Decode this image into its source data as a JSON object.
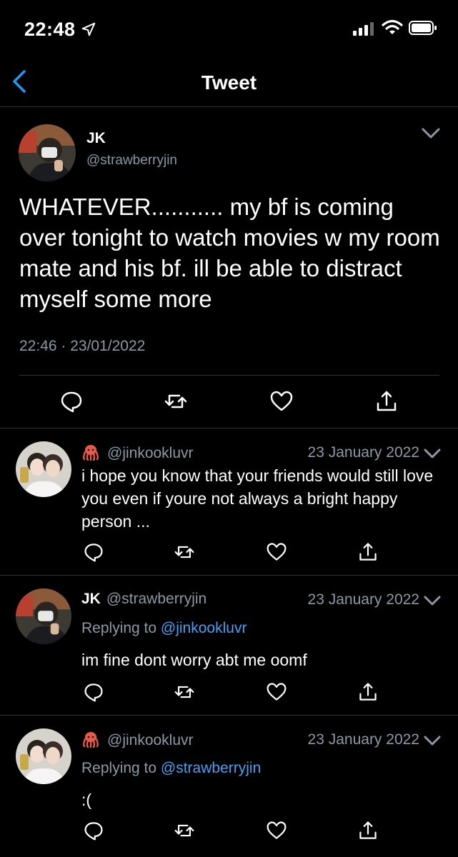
{
  "status_bar": {
    "time": "22:48",
    "icons": [
      "location-arrow-icon",
      "signal-bars-icon",
      "wifi-icon",
      "battery-icon"
    ]
  },
  "nav": {
    "title": "Tweet",
    "back_icon": "chevron-left-icon"
  },
  "main_tweet": {
    "name": "JK",
    "handle": "@strawberryjin",
    "text": "WHATEVER........... my bf is coming over tonight to watch movies w my room mate and his bf. ill be able to distract myself some more",
    "timestamp": "22:46 · 23/01/2022",
    "actions": [
      "reply-icon",
      "retweet-icon",
      "like-icon",
      "share-icon"
    ]
  },
  "replies": [
    {
      "emoji_icon": "octopus-icon",
      "name": "",
      "handle": "@jinkookluvr",
      "date": "23 January 2022",
      "replying_to_label": "",
      "replying_to_handle": "",
      "text": "i hope you know that your friends would still love you even if youre not always a bright happy person ..."
    },
    {
      "emoji_icon": "",
      "name": "JK",
      "handle": "@strawberryjin",
      "date": "23 January 2022",
      "replying_to_label": "Replying to",
      "replying_to_handle": "@jinkookluvr",
      "text": "im fine dont worry abt me oomf"
    },
    {
      "emoji_icon": "octopus-icon",
      "name": "",
      "handle": "@jinkookluvr",
      "date": "23 January 2022",
      "replying_to_label": "Replying to",
      "replying_to_handle": "@strawberryjin",
      "text": ":("
    }
  ],
  "colors": {
    "background": "#000000",
    "text": "#ffffff",
    "secondary_text": "#8b98a5",
    "link": "#4a9ff0",
    "accent_back": "#1d9bf0",
    "divider": "#2f3336"
  }
}
